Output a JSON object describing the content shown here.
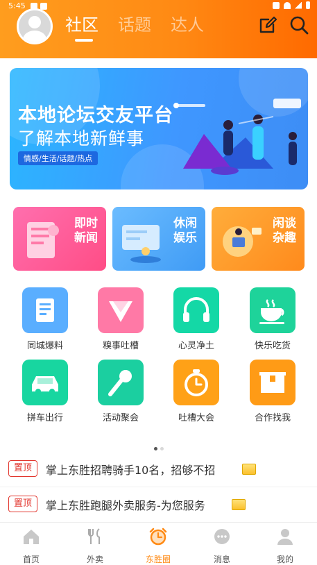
{
  "status": {
    "time": "5:45"
  },
  "header": {
    "tabs": [
      {
        "label": "社区",
        "active": true
      },
      {
        "label": "话题",
        "active": false
      },
      {
        "label": "达人",
        "active": false
      }
    ],
    "accent": "#ff8a14"
  },
  "banner": {
    "title": "本地论坛交友平台",
    "subtitle": "了解本地新鲜事",
    "tags": "情感/生活/话题/热点"
  },
  "cards": [
    {
      "label": "即时新闻"
    },
    {
      "label": "休闲娱乐"
    },
    {
      "label": "闲谈杂趣"
    }
  ],
  "grid": [
    {
      "label": "同城爆料",
      "icon": "news-icon",
      "color": "#5aaeff"
    },
    {
      "label": "糗事吐槽",
      "icon": "diamond-icon",
      "color": "#ff79a6"
    },
    {
      "label": "心灵净土",
      "icon": "headphones-icon",
      "color": "#14d8a6"
    },
    {
      "label": "快乐吃货",
      "icon": "cup-icon",
      "color": "#1ed39a"
    },
    {
      "label": "拼车出行",
      "icon": "car-icon",
      "color": "#18d6a0"
    },
    {
      "label": "活动聚会",
      "icon": "microphone-icon",
      "color": "#1bcfa0"
    },
    {
      "label": "吐槽大会",
      "icon": "stopwatch-icon",
      "color": "#ffa117"
    },
    {
      "label": "合作找我",
      "icon": "box-icon",
      "color": "#ff9b16"
    }
  ],
  "news": [
    {
      "pin": "置顶",
      "title": "掌上东胜招聘骑手10名，招够不招",
      "pin_color": "#e2362e"
    },
    {
      "pin": "置顶",
      "title": "掌上东胜跑腿外卖服务-为您服务",
      "pin_color": "#e2362e"
    }
  ],
  "nav": [
    {
      "label": "首页",
      "icon": "home-icon",
      "active": false
    },
    {
      "label": "外卖",
      "icon": "cutlery-icon",
      "active": false
    },
    {
      "label": "东胜圈",
      "icon": "alarm-clock-icon",
      "active": true
    },
    {
      "label": "消息",
      "icon": "message-icon",
      "active": false
    },
    {
      "label": "我的",
      "icon": "user-icon",
      "active": false
    }
  ]
}
